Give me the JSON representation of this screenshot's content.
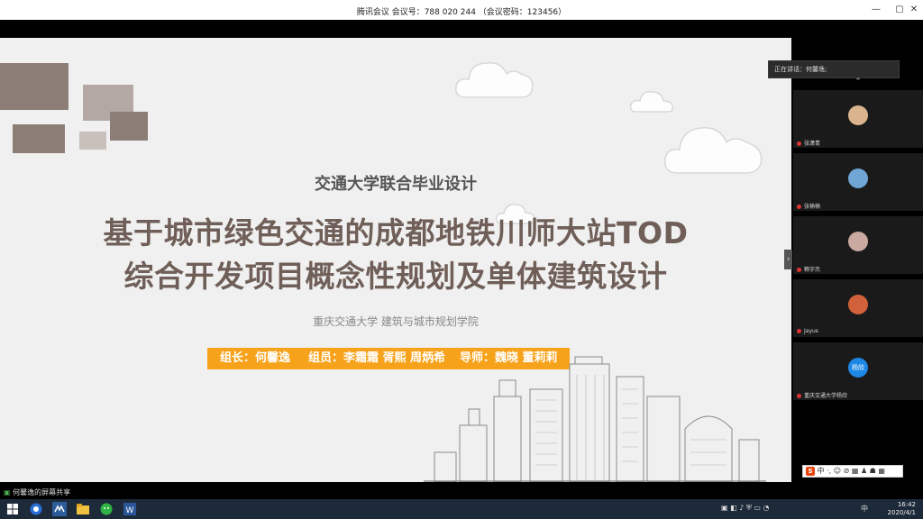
{
  "window": {
    "title": "腾讯会议 会议号：788 020 244  （会议密码：123456）",
    "controls": [
      "—",
      "▢",
      "✕"
    ]
  },
  "slide": {
    "subtitle": "交通大学联合毕业设计",
    "title_line1": "基于城市绿色交通的成都地铁川师大站TOD",
    "title_line2": "综合开发项目概念性规划及单体建筑设计",
    "school": "重庆交通大学  建筑与城市规划学院",
    "team": {
      "leader": "组长：何馨逸",
      "members": "组员：李霜霜 胥熙 周炳希",
      "advisors": "导师：魏晓 董莉莉"
    }
  },
  "speaker_label": "正在讲话：何馨逸;",
  "participants": [
    {
      "name": "张潇青",
      "avatar_color": "#d9b48f"
    },
    {
      "name": "张楠楠",
      "avatar_color": "#6fa6d6"
    },
    {
      "name": "赖宇杰",
      "avatar_color": "#c9a9a0"
    },
    {
      "name": "Jayus",
      "avatar_color": "#d0613a"
    },
    {
      "name": "重庆交通大学杨欣",
      "avatar_color": "#1e88e5",
      "initial": "杨欣"
    }
  ],
  "ime": {
    "logo": "S",
    "text": "中 ·, ☺ ⊘ ▦ ♟ ☗ ▦"
  },
  "share_status": "何馨逸的屏幕共享",
  "taskbar": {
    "tray_text": "中",
    "time": "16:42",
    "date": "2020/4/1"
  },
  "colors": {
    "accent": "#f7a21b",
    "title_text": "#6f5f58",
    "taskbar": "#1d2a3a"
  }
}
